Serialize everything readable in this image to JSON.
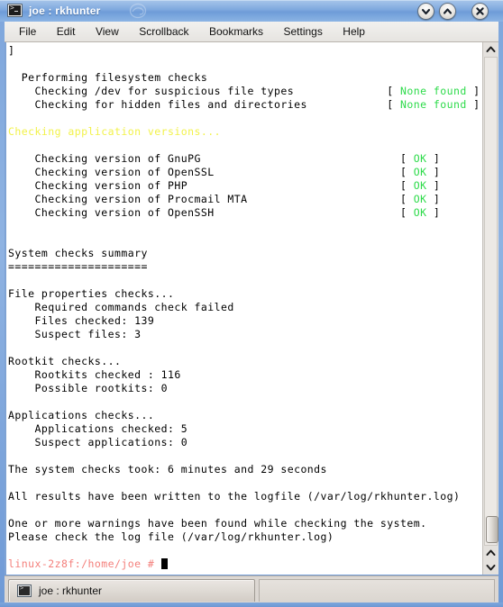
{
  "window": {
    "title": "joe : rkhunter",
    "icon": "terminal-icon",
    "logo": "suse-gecko-logo",
    "buttons": {
      "shade_label": "Shade",
      "maximize_label": "Maximize",
      "close_label": "Close"
    }
  },
  "menubar": {
    "items": [
      {
        "label": "File"
      },
      {
        "label": "Edit"
      },
      {
        "label": "View"
      },
      {
        "label": "Scrollback"
      },
      {
        "label": "Bookmarks"
      },
      {
        "label": "Settings"
      },
      {
        "label": "Help"
      }
    ]
  },
  "terminal": {
    "lines": [
      {
        "text": "]",
        "color": "black"
      },
      {
        "text": "",
        "color": "black"
      },
      {
        "text": "  Performing filesystem checks",
        "color": "black"
      },
      {
        "text": "    Checking /dev for suspicious file types              [ ",
        "color": "black",
        "status": "None found",
        "status_color": "green",
        "tail": " ]"
      },
      {
        "text": "    Checking for hidden files and directories            [ ",
        "color": "black",
        "status": "None found",
        "status_color": "green",
        "tail": " ]"
      },
      {
        "text": "",
        "color": "black"
      },
      {
        "text": "Checking application versions...",
        "color": "yellow"
      },
      {
        "text": "",
        "color": "black"
      },
      {
        "text": "    Checking version of GnuPG                              [ ",
        "color": "black",
        "status": "OK",
        "status_color": "green",
        "tail": " ]"
      },
      {
        "text": "    Checking version of OpenSSL                            [ ",
        "color": "black",
        "status": "OK",
        "status_color": "green",
        "tail": " ]"
      },
      {
        "text": "    Checking version of PHP                                [ ",
        "color": "black",
        "status": "OK",
        "status_color": "green",
        "tail": " ]"
      },
      {
        "text": "    Checking version of Procmail MTA                       [ ",
        "color": "black",
        "status": "OK",
        "status_color": "green",
        "tail": " ]"
      },
      {
        "text": "    Checking version of OpenSSH                            [ ",
        "color": "black",
        "status": "OK",
        "status_color": "green",
        "tail": " ]"
      },
      {
        "text": "",
        "color": "black"
      },
      {
        "text": "",
        "color": "black"
      },
      {
        "text": "System checks summary",
        "color": "black"
      },
      {
        "text": "=====================",
        "color": "black"
      },
      {
        "text": "",
        "color": "black"
      },
      {
        "text": "File properties checks...",
        "color": "black"
      },
      {
        "text": "    Required commands check failed",
        "color": "black"
      },
      {
        "text": "    Files checked: 139",
        "color": "black"
      },
      {
        "text": "    Suspect files: 3",
        "color": "black"
      },
      {
        "text": "",
        "color": "black"
      },
      {
        "text": "Rootkit checks...",
        "color": "black"
      },
      {
        "text": "    Rootkits checked : 116",
        "color": "black"
      },
      {
        "text": "    Possible rootkits: 0",
        "color": "black"
      },
      {
        "text": "",
        "color": "black"
      },
      {
        "text": "Applications checks...",
        "color": "black"
      },
      {
        "text": "    Applications checked: 5",
        "color": "black"
      },
      {
        "text": "    Suspect applications: 0",
        "color": "black"
      },
      {
        "text": "",
        "color": "black"
      },
      {
        "text": "The system checks took: 6 minutes and 29 seconds",
        "color": "black"
      },
      {
        "text": "",
        "color": "black"
      },
      {
        "text": "All results have been written to the logfile (/var/log/rkhunter.log)",
        "color": "black"
      },
      {
        "text": "",
        "color": "black"
      },
      {
        "text": "One or more warnings have been found while checking the system.",
        "color": "black"
      },
      {
        "text": "Please check the log file (/var/log/rkhunter.log)",
        "color": "black"
      },
      {
        "text": "",
        "color": "black"
      },
      {
        "text": "linux-2z8f:/home/joe # ",
        "color": "prompt",
        "cursor": true
      }
    ],
    "colors": {
      "foreground": "#000000",
      "background": "#ffffff",
      "green": "#2ddb4a",
      "yellow": "#f2f24a",
      "prompt": "#f4807c"
    }
  },
  "scrollbar": {
    "arrow_top": "chevron-up-icon",
    "arrow_bottom_up": "chevron-up-icon",
    "arrow_bottom_down": "chevron-down-icon",
    "thumb_position": "bottom"
  },
  "tabbar": {
    "tabs": [
      {
        "label": "joe : rkhunter",
        "icon": "terminal-icon",
        "active": true
      }
    ]
  }
}
